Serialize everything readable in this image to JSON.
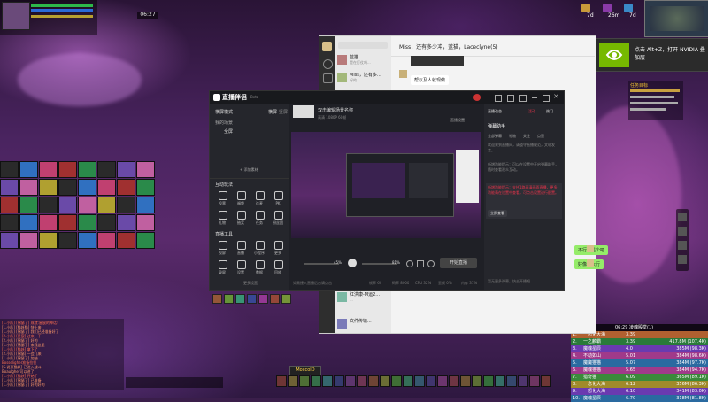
{
  "game": {
    "clock": "06:27",
    "minimap_stats": [
      "7d",
      "26m",
      "7d"
    ],
    "chat_lines": [
      "[1.小队] [锦瑟了] 成就:星宸的神话！",
      "[1.小队] [猫妖猫] 快上来！",
      "[1.小队] [锦瑟了] 我们已经准备好了",
      "[2.小队] [星宸] 过来一下",
      "[2.小队] [锦瑟了] 好的",
      "[1.小队] [锦瑟了] 来我这里",
      "[1.小队] [猫妖] 拿下了",
      "[2.小队] [锦瑟] 一会儿来",
      "[1.小队] [锦瑟了] 加油",
      "Bosseligher准备拉怪",
      "[S.说] [猫妖] 已进入战斗",
      "Boaulgher可以进了",
      "[1.小队] [猫妖] 开始了",
      "[1.小队] [锦瑟了] 已准备",
      "[1.小队] [锦瑟了] 好的好的"
    ],
    "action_bar_label": "MoccoID",
    "damage_meter": {
      "header": "06:29 凌魂殿堂(1)",
      "rows": [
        {
          "rank": "1.",
          "name": "一怒化大海",
          "val": "3.39",
          "extra": ""
        },
        {
          "rank": "2.",
          "name": "一之麟霸",
          "val": "3.39",
          "extra": "417.8M (107.4K)"
        },
        {
          "rank": "3.",
          "name": "魔魂星辰",
          "val": "4.0",
          "extra": "385M (98.3K)"
        },
        {
          "rank": "4.",
          "name": "不动如山",
          "val": "5.01",
          "extra": "384M (98.6K)"
        },
        {
          "rank": "5.",
          "name": "魔魔猫猫",
          "val": "5.07",
          "extra": "384M (97.7K)"
        },
        {
          "rank": "6.",
          "name": "魔魂猫猫",
          "val": "5.65",
          "extra": "384M (94.7K)"
        },
        {
          "rank": "7.",
          "name": "猎奇猫",
          "val": "6.09",
          "extra": "365M (89.1K)"
        },
        {
          "rank": "8.",
          "name": "一念化大海",
          "val": "6.12",
          "extra": "356M (86.3K)"
        },
        {
          "rank": "9.",
          "name": "一怒化大海",
          "val": "6.10",
          "extra": "341M (83.0K)"
        },
        {
          "rank": "10.",
          "name": "魔魂星辰",
          "val": "6.70",
          "extra": "318M (81.8K)"
        }
      ]
    },
    "right_tracker": "任务目标"
  },
  "nvidia": {
    "text": "点击 Alt+Z，打开 NVIDIA 叠加层",
    "logo": "nvidia-logo-icon"
  },
  "wechat": {
    "title": "Miss，还有多少冲，蓝猫，Laceclyne(5)",
    "chat_items": [
      {
        "name": "蓝猫",
        "preview": "是在打仗吗..."
      },
      {
        "name": "Miss，还有多...",
        "preview": "好的..."
      },
      {
        "name": "红洪康-M运2...",
        "preview": "..."
      },
      {
        "name": "文件传输...",
        "preview": ""
      }
    ],
    "bubble_left": "帮以及人就现做",
    "bubble_right_1": "不行，是个吧",
    "bubble_right_2": "好像不太行"
  },
  "streamer": {
    "app_name": "直播伴侣",
    "version": "Beta",
    "mode_label": "横屏模式",
    "tabs_top": [
      "横屏",
      "竖屏"
    ],
    "scene_header": "我的场景",
    "scene_item": "全屏",
    "add_scene": "+ 添加素材",
    "interactive_title": "互动玩法",
    "interactive_items": [
      "投票",
      "福袋",
      "连麦",
      "PK",
      "礼物",
      "抽奖",
      "任务",
      "粉丝团"
    ],
    "tools_title": "直播工具",
    "tools_items": [
      "投屏",
      "直播",
      "小程序",
      "更多",
      "录屏",
      "设置",
      "数据",
      "回放"
    ],
    "more_label": "更多设置",
    "preview_title": "双击编辑场景名称",
    "preview_sub": "高清 1080P 60帧",
    "broadcast_tab_label": "直播设置",
    "zoom_left": "45%",
    "zoom_right": "81%",
    "start_button": "开始直播",
    "status_items": [
      "帧率 60",
      "码率 8000",
      "CPU 32%",
      "丢帧 0%",
      "内存 31%"
    ],
    "bottom_hint": "如需接入直播后台请点击",
    "right_panel": {
      "tabs": [
        "直播动态",
        "活动",
        "热门"
      ],
      "title": "弹幕助手",
      "sub_tabs": [
        "全部弹幕",
        "礼物",
        "关注",
        "点赞"
      ],
      "notice_1": "欢迎来到直播间，请遵守直播规范，文明发言。",
      "notice_2": "新增功能提示：可以在设置中开启弹幕助手，随时查看观众互动。",
      "highlight": "新增功能提示：支持1路高清画面直播，更多功能请在设置中查看，可点击设置进行配置。",
      "link": "立即查看",
      "footer": "暂无更多弹幕，快去开播吧"
    }
  },
  "colors": {
    "accent_red": "#e8334a",
    "panel": "#1f2026",
    "wechat_bg": "#f3f3f3",
    "wechat_green": "#95ec69",
    "nvidia_green": "#76b900"
  }
}
